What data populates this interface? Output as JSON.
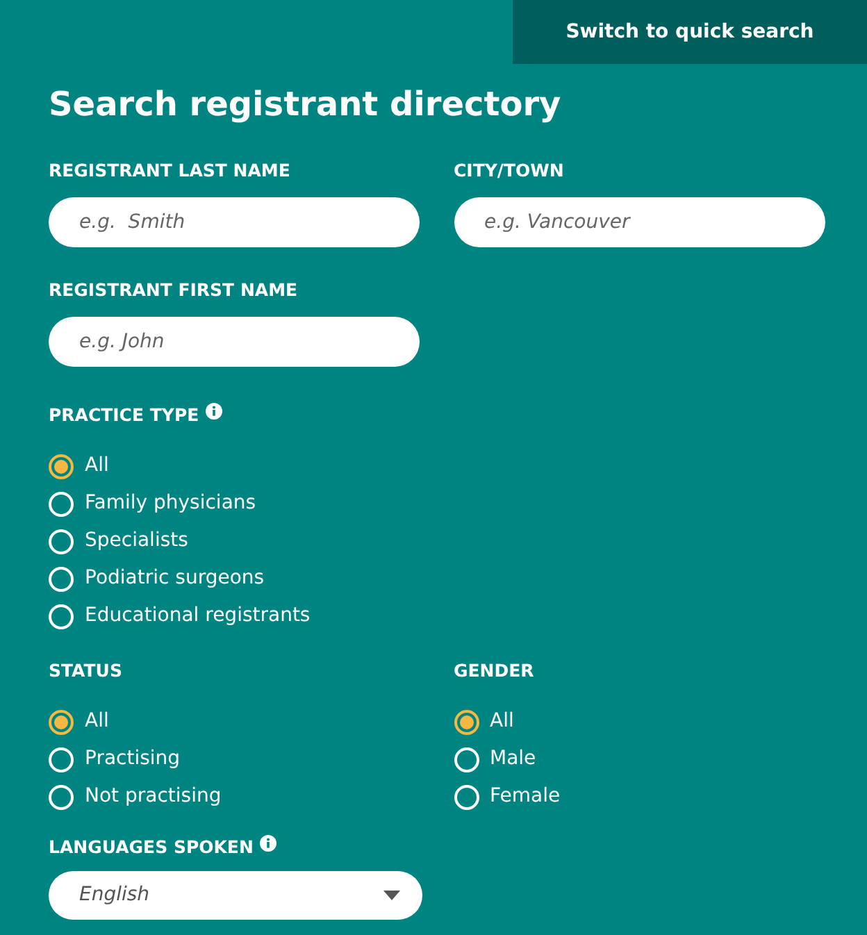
{
  "header": {
    "quick_search_link": "Switch to quick search"
  },
  "title": "Search registrant directory",
  "text_fields": [
    {
      "label": "REGISTRANT LAST NAME",
      "placeholder": "e.g.  Smith"
    },
    {
      "label": "CITY/TOWN",
      "placeholder": "e.g. Vancouver"
    },
    {
      "label": "REGISTRANT FIRST NAME",
      "placeholder": "e.g. John"
    }
  ],
  "practice_type": {
    "label": "PRACTICE TYPE",
    "info": true,
    "options": [
      {
        "label": "All",
        "selected": true
      },
      {
        "label": "Family physicians",
        "selected": false
      },
      {
        "label": "Specialists",
        "selected": false
      },
      {
        "label": "Podiatric surgeons",
        "selected": false
      },
      {
        "label": "Educational registrants",
        "selected": false
      }
    ]
  },
  "status": {
    "label": "STATUS",
    "options": [
      {
        "label": "All",
        "selected": true
      },
      {
        "label": "Practising",
        "selected": false
      },
      {
        "label": "Not practising",
        "selected": false
      }
    ]
  },
  "gender": {
    "label": "GENDER",
    "options": [
      {
        "label": "All",
        "selected": true
      },
      {
        "label": "Male",
        "selected": false
      },
      {
        "label": "Female",
        "selected": false
      }
    ]
  },
  "languages": {
    "label": "LANGUAGES SPOKEN",
    "info": true,
    "value": "English"
  }
}
